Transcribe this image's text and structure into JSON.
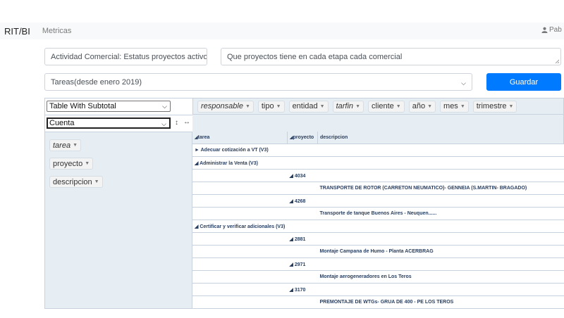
{
  "navbar": {
    "brand": "RIT/BI",
    "link": "Metricas",
    "user": "Pab"
  },
  "form": {
    "report_name": "Actividad Comercial: Estatus proyectos activo",
    "question": "Que proyectos tiene en cada etapa cada comercial",
    "task_select": "Tareas(desde enero 2019)",
    "save_label": "Guardar"
  },
  "pivot": {
    "renderer": "Table With Subtotal",
    "aggregator": "Cuenta",
    "col_attrs": [
      {
        "label": "responsable",
        "italic": true
      },
      {
        "label": "tipo",
        "italic": false
      },
      {
        "label": "entidad",
        "italic": false
      },
      {
        "label": "tarfin",
        "italic": true
      },
      {
        "label": "cliente",
        "italic": false
      },
      {
        "label": "año",
        "italic": false
      },
      {
        "label": "mes",
        "italic": false
      },
      {
        "label": "trimestre",
        "italic": false
      }
    ],
    "row_attrs": [
      {
        "label": "tarea",
        "italic": true
      },
      {
        "label": "proyecto",
        "italic": false
      },
      {
        "label": "descripcion",
        "italic": false
      }
    ],
    "table_headers": [
      "tarea",
      "proyecto",
      "descripcion"
    ],
    "rows": [
      {
        "c1": "► Adecuar cotización a VT (V3)",
        "c2": "",
        "c3": ""
      },
      {
        "c1": "◢ Administrar la Venta (V3)",
        "c2": "",
        "c3": ""
      },
      {
        "c1": "",
        "c2": "◢ 4034",
        "c3": ""
      },
      {
        "c1": "",
        "c2": "",
        "c3": "TRANSPORTE DE ROTOR (CARRETON NEUMATICO)- GENNEIA (S.MARTIN- BRAGADO)"
      },
      {
        "c1": "",
        "c2": "◢ 4268",
        "c3": ""
      },
      {
        "c1": "",
        "c2": "",
        "c3": "Transporte de tanque Buenos Aires - Neuquen......"
      },
      {
        "c1": "◢ Certificar y verificar adicionales (V3)",
        "c2": "",
        "c3": ""
      },
      {
        "c1": "",
        "c2": "◢ 2881",
        "c3": ""
      },
      {
        "c1": "",
        "c2": "",
        "c3": "Montaje Campana de Humo - Planta ACERBRAG"
      },
      {
        "c1": "",
        "c2": "◢ 2971",
        "c3": ""
      },
      {
        "c1": "",
        "c2": "",
        "c3": "Montaje aerogeneradores en Los Teros"
      },
      {
        "c1": "",
        "c2": "◢ 3170",
        "c3": ""
      },
      {
        "c1": "",
        "c2": "",
        "c3": "PREMONTAJE DE WTGs- GRUA DE 400 - PE LOS TEROS"
      }
    ]
  },
  "colors": {
    "primary": "#007bff",
    "pivot_bg": "#e6edf3",
    "pivot_border": "#c8d2dc",
    "navbar_bg": "#f8f9fa"
  },
  "icons": [
    "user-icon",
    "chevron-down-icon",
    "sort-icon",
    "expand-icon",
    "resize-grip-icon"
  ]
}
